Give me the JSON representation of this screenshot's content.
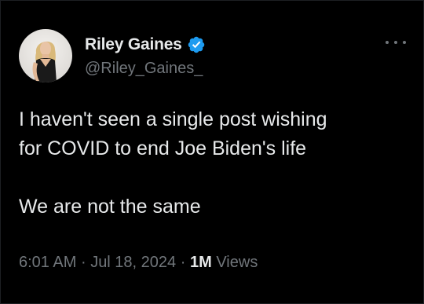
{
  "tweet": {
    "author": {
      "display_name": "Riley Gaines",
      "handle": "@Riley_Gaines_",
      "verified": true,
      "verified_color": "#1d9bf0"
    },
    "text_lines": [
      "I haven't seen a single post wishing",
      "for COVID to end Joe Biden's life",
      "",
      "We are not the same"
    ],
    "time": "6:01 AM",
    "separator": "·",
    "date": "Jul 18, 2024",
    "views_count": "1M",
    "views_label": "Views"
  },
  "icons": {
    "more": "more-horizontal-icon",
    "verified": "verified-badge-icon"
  },
  "colors": {
    "background": "#000000",
    "text_primary": "#e7e9ea",
    "text_secondary": "#71767b"
  }
}
